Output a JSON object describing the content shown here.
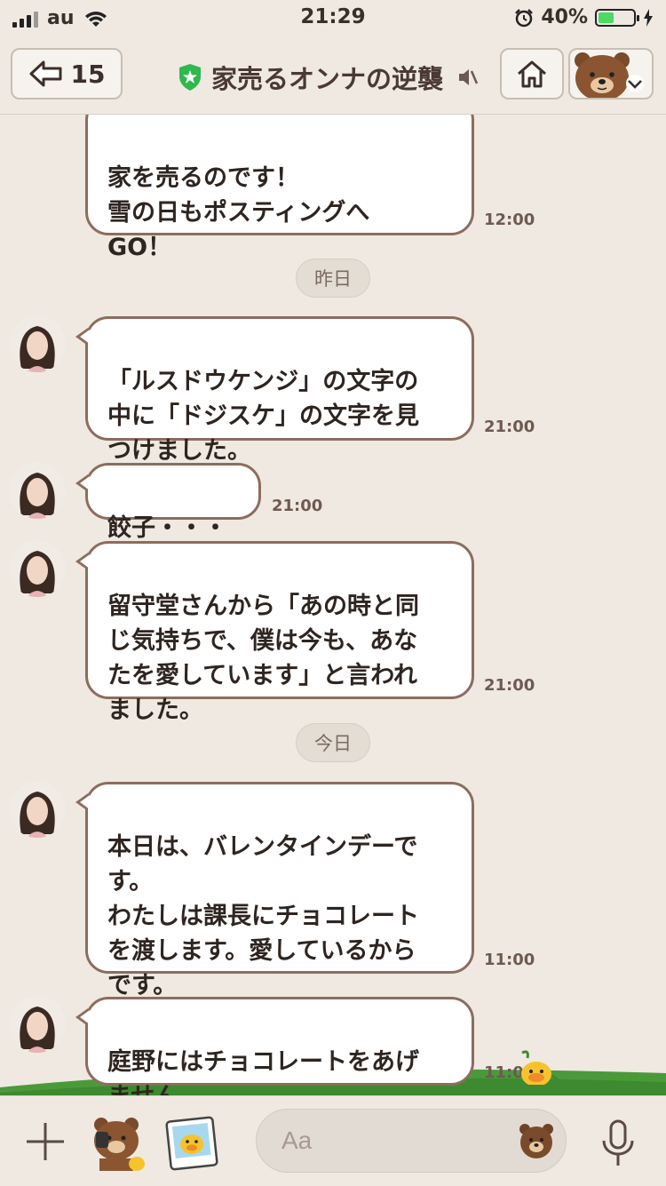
{
  "status_bar": {
    "carrier": "au",
    "time": "21:29",
    "battery": "40%",
    "battery_level": 0.4
  },
  "header": {
    "back_count": "15",
    "title": "家売るオンナの逆襲",
    "icons": [
      "back-arrow-icon",
      "shield-star-icon",
      "mute-icon",
      "home-icon",
      "brown-bear-icon",
      "chevron-down-icon"
    ]
  },
  "messages": [
    {
      "text": "家を売るのです！\n雪の日もポスティングへ\nGO！",
      "time": "12:00"
    },
    {
      "text": "「ルスドウケンジ」の文字の\n中に「ドジスケ」の文字を見\nつけました。",
      "time": "21:00"
    },
    {
      "text": "餃子・・・",
      "time": "21:00"
    },
    {
      "text": "留守堂さんから「あの時と同\nじ気持ちで、僕は今も、あな\nたを愛しています」と言われ\nました。",
      "time": "21:00"
    },
    {
      "text": "本日は、バレンタインデーで\nす。\nわたしは課長にチョコレート\nを渡します。愛しているから\nです。",
      "time": "11:00"
    },
    {
      "text": "庭野にはチョコレートをあげ\nません。",
      "time": "11:00"
    }
  ],
  "date_separators": [
    "昨日",
    "今日"
  ],
  "input": {
    "placeholder": "Aa",
    "icons": [
      "plus-icon",
      "bear-sticker-icon",
      "chick-photo-icon",
      "emoji-bear-icon",
      "microphone-icon"
    ]
  },
  "colors": {
    "background": "#efe9e2",
    "bubble_border": "#8c6d5e",
    "battery_fill": "#4cd964",
    "hill": "#4a9a3a"
  }
}
